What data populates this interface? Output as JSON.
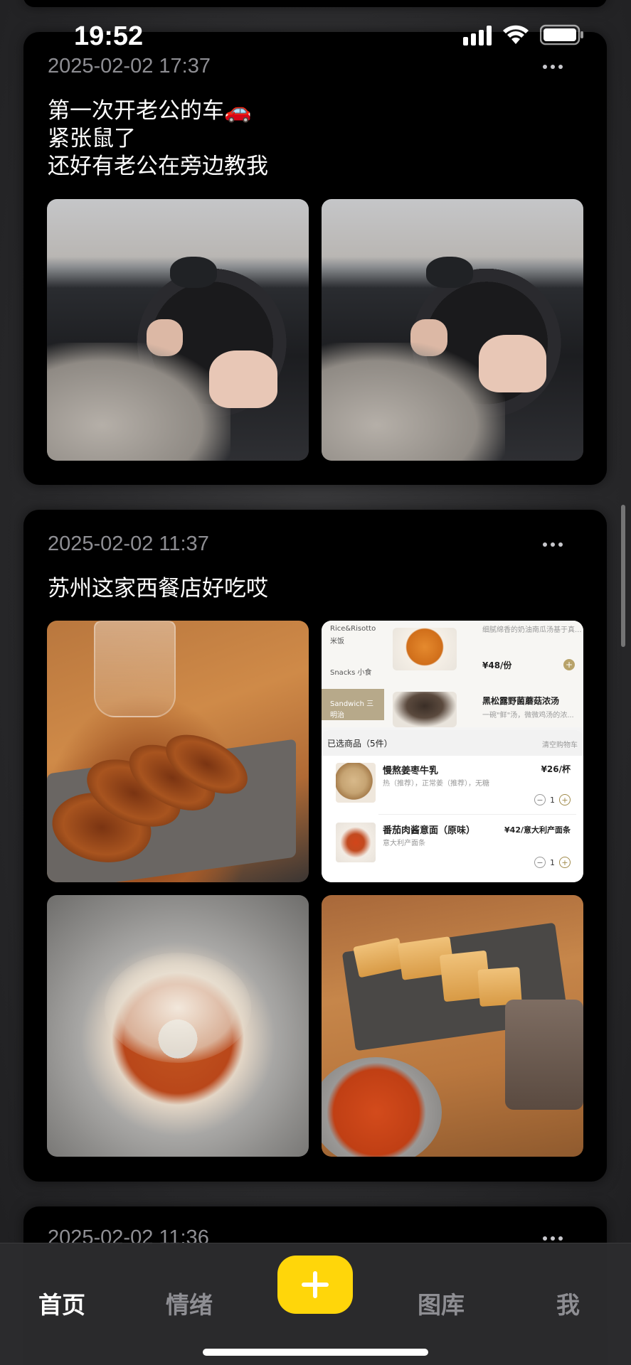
{
  "status_bar": {
    "time": "19:52"
  },
  "posts": [
    {
      "date": "2025-02-02 17:37",
      "text": "第一次开老公的车🚗\n紧张鼠了\n还好有老公在旁边教我"
    },
    {
      "date": "2025-02-02 11:37",
      "text": "苏州这家西餐店好吃哎"
    },
    {
      "date": "2025-02-02 11:36"
    }
  ],
  "menu_screenshot": {
    "categories": [
      "Rice&Risotto",
      "米饭",
      "Snacks 小食",
      "Sandwich 三",
      "明治"
    ],
    "top_item_desc": "细腻绵香的奶油南瓜汤基于真...",
    "top_item_price": "¥48/份",
    "second_item_name": "黑松露野菌蘑菇浓汤",
    "second_item_desc": "一碗\"鲜\"汤，微微鸡汤的浓...",
    "selected_header": "已选商品（5件）",
    "clear_cart": "清空购物车",
    "items": [
      {
        "name": "慢熬姜枣牛乳",
        "desc": "热（推荐），正常姜（推荐），无糖",
        "price": "¥26/杯",
        "qty": "1"
      },
      {
        "name": "番茄肉酱意面（原味）",
        "desc": "意大利产面条",
        "price": "¥42/意大利产面条",
        "qty": "1"
      }
    ]
  },
  "tab_bar": {
    "tabs": [
      {
        "label": "首页",
        "active": true
      },
      {
        "label": "情绪",
        "active": false
      },
      {
        "label": "图库",
        "active": false
      },
      {
        "label": "我",
        "active": false
      }
    ],
    "add_icon": "plus-icon",
    "accent": "#ffd60a"
  }
}
